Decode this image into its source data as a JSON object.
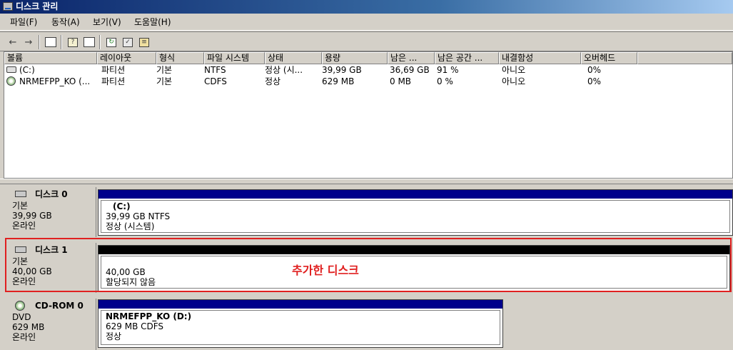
{
  "window": {
    "title": "디스크 관리"
  },
  "menu": [
    "파일(F)",
    "동작(A)",
    "보기(V)",
    "도움말(H)"
  ],
  "toolbar_icons": [
    "back-arrow-icon",
    "forward-arrow-icon",
    "console-tree-icon",
    "help-icon",
    "properties-pane-icon",
    "refresh-icon",
    "properties-icon",
    "export-icon"
  ],
  "volumes": {
    "columns": [
      "볼륨",
      "레이아웃",
      "형식",
      "파일 시스템",
      "상태",
      "용량",
      "남은 ...",
      "남은 공간 ...",
      "내결함성",
      "오버헤드"
    ],
    "rows": [
      {
        "icon": "hard-disk-volume-icon",
        "cells": [
          "(C:)",
          "파티션",
          "기본",
          "NTFS",
          "정상 (시...",
          "39,99 GB",
          "36,69 GB",
          "91 %",
          "아니오",
          "0%"
        ]
      },
      {
        "icon": "cdrom-volume-icon",
        "cells": [
          "NRMEFPP_KO (...",
          "파티션",
          "기본",
          "CDFS",
          "정상",
          "629 MB",
          "0 MB",
          "0 %",
          "아니오",
          "0%"
        ]
      }
    ]
  },
  "disks": [
    {
      "title": "디스크 0",
      "type": "기본",
      "size": "39,99 GB",
      "state": "온라인",
      "icon": "hard-disk-icon",
      "volume": {
        "name": "(C:)",
        "detail": "39,99 GB NTFS",
        "status": "정상 (시스템)",
        "bar_color": "#00008b"
      }
    },
    {
      "title": "디스크 1",
      "type": "기본",
      "size": "40,00 GB",
      "state": "온라인",
      "icon": "hard-disk-icon",
      "volume": {
        "name": "",
        "detail": "40,00 GB",
        "status": "할당되지 않음",
        "bar_color": "#000000"
      }
    },
    {
      "title": "CD-ROM 0",
      "type": "DVD",
      "size": "629 MB",
      "state": "온라인",
      "icon": "cdrom-icon",
      "volume": {
        "name": "NRMEFPP_KO  (D:)",
        "detail": "629 MB CDFS",
        "status": "정상",
        "bar_color": "#00008b"
      }
    }
  ],
  "annotation": {
    "text": "추가한 디스크",
    "color": "#e02020"
  }
}
